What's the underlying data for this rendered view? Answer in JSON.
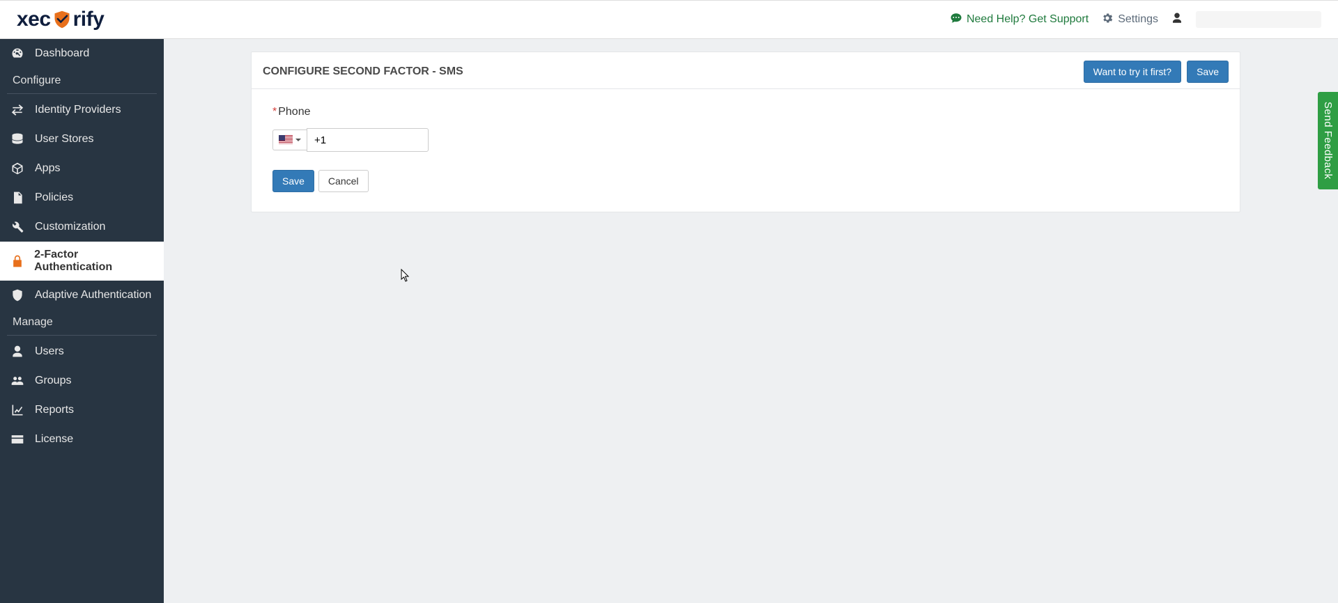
{
  "brand": {
    "part1": "xec",
    "part2": "rify"
  },
  "topbar": {
    "help": "Need Help? Get Support",
    "settings": "Settings"
  },
  "sidebar": {
    "items": [
      {
        "label": "Dashboard"
      },
      {
        "label": "Identity Providers"
      },
      {
        "label": "User Stores"
      },
      {
        "label": "Apps"
      },
      {
        "label": "Policies"
      },
      {
        "label": "Customization"
      },
      {
        "label": "2-Factor Authentication"
      },
      {
        "label": "Adaptive Authentication"
      },
      {
        "label": "Users"
      },
      {
        "label": "Groups"
      },
      {
        "label": "Reports"
      },
      {
        "label": "License"
      }
    ],
    "sections": {
      "configure": "Configure",
      "manage": "Manage"
    }
  },
  "card": {
    "title": "CONFIGURE SECOND FACTOR - SMS",
    "try_btn": "Want to try it first?",
    "save_btn": "Save"
  },
  "form": {
    "phone_label": "Phone",
    "dial_code": "+1",
    "country_name": "United States",
    "save_label": "Save",
    "cancel_label": "Cancel"
  },
  "feedback": "Send Feedback"
}
